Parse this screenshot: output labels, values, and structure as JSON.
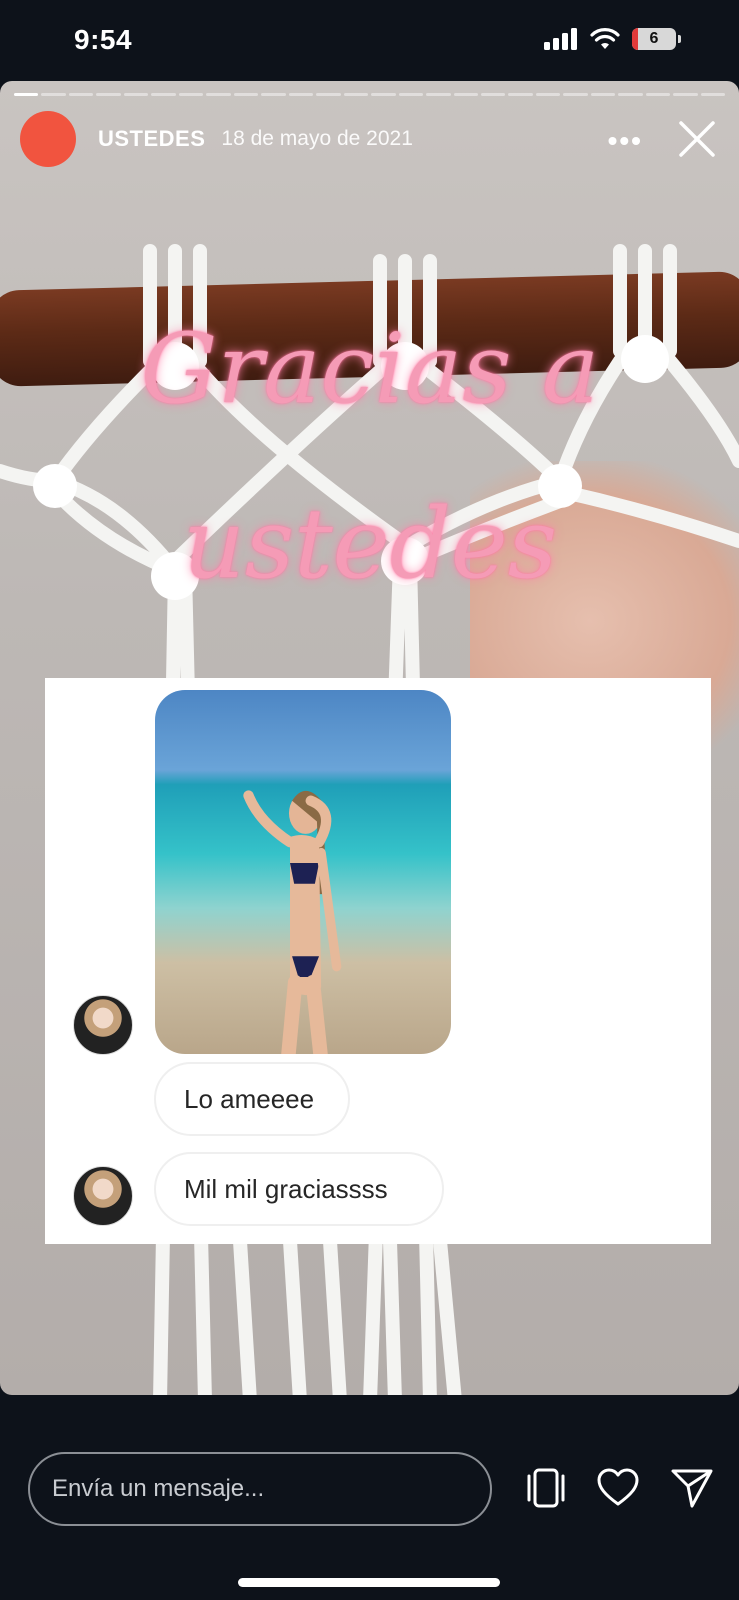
{
  "status_bar": {
    "time": "9:54",
    "battery_level": "6"
  },
  "story": {
    "username": "USTEDES",
    "date": "18 de mayo de 2021",
    "headline_line1": "Gracias a",
    "headline_line2": "ustedes",
    "progress_segments": 26,
    "active_segment": 1
  },
  "chat": {
    "messages": [
      {
        "text": "Lo ameeee"
      },
      {
        "text": "Mil mil graciassss"
      }
    ]
  },
  "bottom_bar": {
    "message_placeholder": "Envía un mensaje..."
  },
  "colors": {
    "avatar": "#f1543f",
    "headline": "#f59bb6",
    "background": "#0d121a"
  }
}
